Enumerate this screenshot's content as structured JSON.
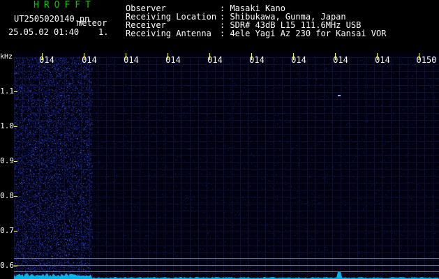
{
  "header": {
    "app_title": "HROFFT",
    "file_name": "UT2505020140.pn",
    "meteor_tag": "meteor",
    "timestamp": "25.05.02 01:40",
    "count_tag": "1."
  },
  "station_info": [
    {
      "label": "Observer",
      "value": ": Masaki Kano"
    },
    {
      "label": "Receiving Location",
      "value": ": Shibukawa, Gunma, Japan"
    },
    {
      "label": "Receiver",
      "value": ": SDR# 43dB L15 111.6MHz USB"
    },
    {
      "label": "Receiving Antenna",
      "value": ": 4ele Yagi Az 230 for Kansai VOR"
    }
  ],
  "time_axis": {
    "labels": [
      "014",
      "014",
      "014",
      "014",
      "014",
      "014",
      "014",
      "014",
      "014",
      "0150"
    ]
  },
  "freq_axis": {
    "unit": "kHz",
    "labels": [
      "1.1",
      "1.0",
      "0.9",
      "0.8",
      "0.7",
      "0.6"
    ]
  },
  "colors": {
    "background": "#000000",
    "text": "#ffffff",
    "title": "#00c800",
    "tick_yellow": "#ffff00",
    "grid": "#1c1c44",
    "noise": "#1a2a9a",
    "baseline": "#00c8ff"
  }
}
